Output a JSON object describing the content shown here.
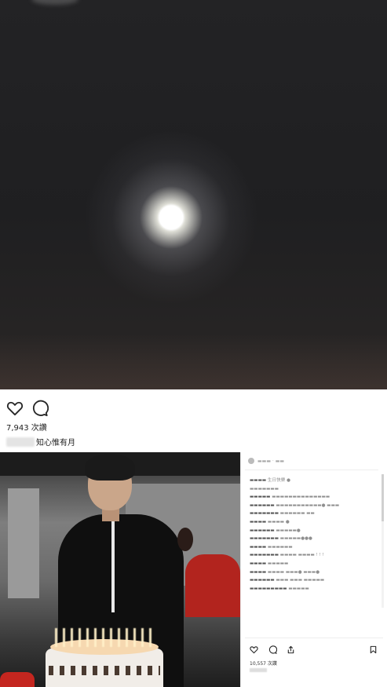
{
  "post_top": {
    "likes_text": "7,943 次讚",
    "caption_text": "知心惟有月",
    "icons": {
      "like": "heart-icon",
      "comment": "comment-icon"
    }
  },
  "post_bottom": {
    "caption_text": "生日快樂",
    "likes_text": "10,557 次讚",
    "icons": {
      "like": "heart-icon",
      "comment": "comment-icon",
      "share": "share-icon",
      "save": "bookmark-icon"
    }
  },
  "colors": {
    "moon_sky": "#222224",
    "jacket": "#0f0f0f",
    "accent_red": "#b2241e"
  }
}
